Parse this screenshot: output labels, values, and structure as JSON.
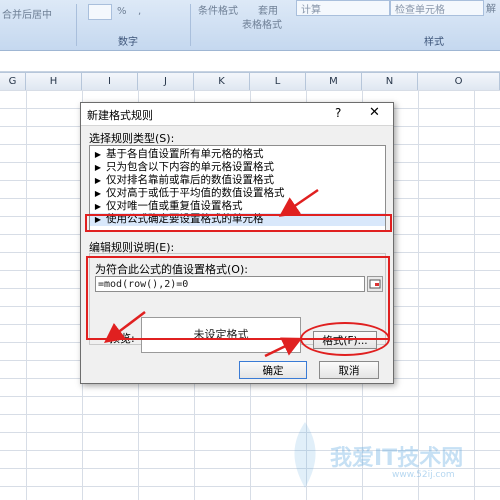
{
  "ribbon": {
    "merge_label": "合并后居中",
    "percent": "%",
    "comma": ",",
    "cond_format": "条件格式",
    "apply": "套用",
    "table_format": "表格格式",
    "calc_cell": "计算",
    "check_cell": "检查单元格",
    "explain": "解",
    "group_number": "数字",
    "group_style": "样式"
  },
  "columns": [
    "G",
    "H",
    "I",
    "J",
    "K",
    "L",
    "M",
    "N",
    "O"
  ],
  "dialog": {
    "title": "新建格式规则",
    "help": "?",
    "close": "✕",
    "rule_type_label": "选择规则类型(S):",
    "rules": [
      "基于各自值设置所有单元格的格式",
      "只为包含以下内容的单元格设置格式",
      "仅对排名靠前或靠后的数值设置格式",
      "仅对高于或低于平均值的数值设置格式",
      "仅对唯一值或重复值设置格式",
      "使用公式确定要设置格式的单元格"
    ],
    "selected_rule_index": 5,
    "edit_label": "编辑规则说明(E):",
    "formula_label": "为符合此公式的值设置格式(O):",
    "formula_value": "=mod(row(),2)=0",
    "preview_label": "预览:",
    "preview_text": "未设定格式",
    "format_button": "格式(F)...",
    "ok_button": "确定",
    "cancel_button": "取消"
  },
  "watermark": {
    "text": "我爱IT技术网",
    "url": "www.52ij.com"
  },
  "colors": {
    "annotation": "#e02020",
    "ribbon": "#c5d8ef"
  }
}
